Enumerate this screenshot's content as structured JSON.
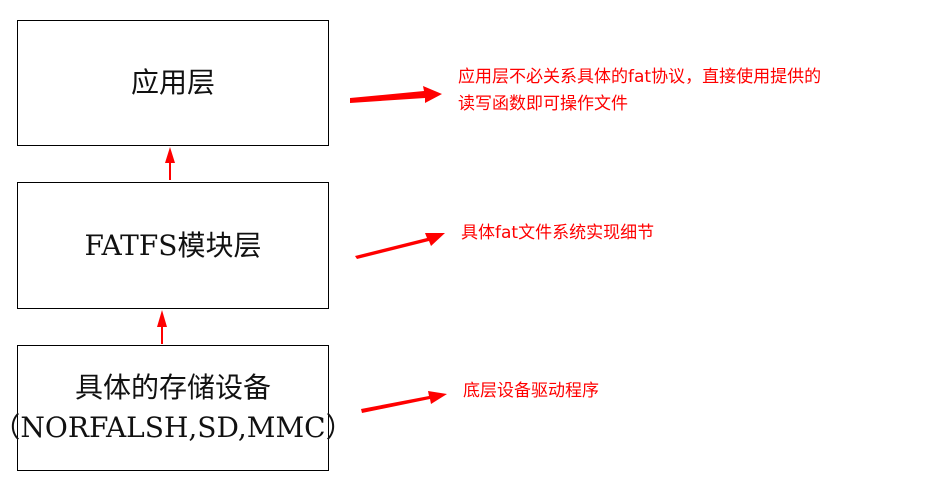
{
  "layers": [
    {
      "lines": [
        "应用层"
      ]
    },
    {
      "lines": [
        "FATFS模块层"
      ]
    },
    {
      "lines": [
        "具体的存储设备",
        "（NORFALSH,SD,MMC）"
      ]
    }
  ],
  "annotations": [
    {
      "lines": [
        "应用层不必关系具体的fat协议，直接使用提供的",
        "读写函数即可操作文件"
      ]
    },
    {
      "lines": [
        "具体fat文件系统实现细节"
      ]
    },
    {
      "lines": [
        "底层设备驱动程序"
      ]
    }
  ],
  "colors": {
    "arrow": "#ff0000",
    "box_border": "#000000",
    "text": "#111111",
    "annotation": "#ff0000"
  }
}
